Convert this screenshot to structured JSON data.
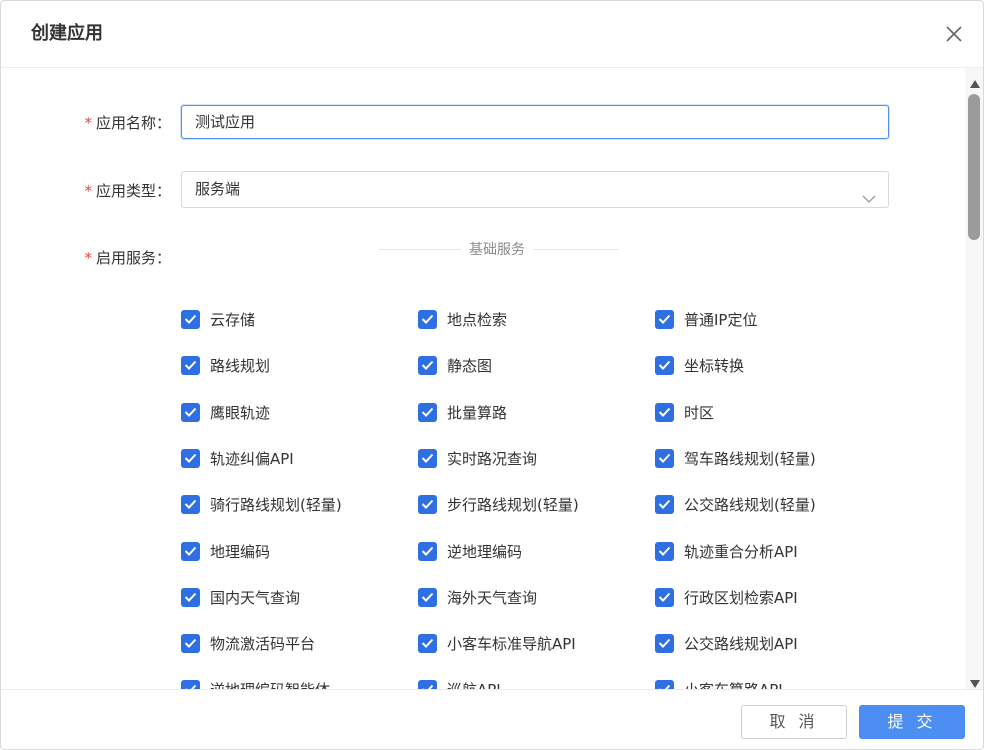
{
  "dialog": {
    "title": "创建应用",
    "close_icon": "close-icon"
  },
  "form": {
    "app_name": {
      "label": "应用名称：",
      "value": "测试应用"
    },
    "app_type": {
      "label": "应用类型：",
      "value": "服务端"
    },
    "services": {
      "label": "启用服务：",
      "group_title": "基础服务"
    }
  },
  "services": [
    [
      "云存储",
      "地点检索",
      "普通IP定位"
    ],
    [
      "路线规划",
      "静态图",
      "坐标转换"
    ],
    [
      "鹰眼轨迹",
      "批量算路",
      "时区"
    ],
    [
      "轨迹纠偏API",
      "实时路况查询",
      "驾车路线规划(轻量)"
    ],
    [
      "骑行路线规划(轻量)",
      "步行路线规划(轻量)",
      "公交路线规划(轻量)"
    ],
    [
      "地理编码",
      "逆地理编码",
      "轨迹重合分析API"
    ],
    [
      "国内天气查询",
      "海外天气查询",
      "行政区划检索API"
    ],
    [
      "物流激活码平台",
      "小客车标准导航API",
      "公交路线规划API"
    ],
    [
      "逆地理编码智能体",
      "巡航API",
      "小客车算路API"
    ]
  ],
  "footer": {
    "cancel_label": "取 消",
    "submit_label": "提 交"
  },
  "colors": {
    "accent": "#4d8ef2",
    "checkbox": "#2f6fe4",
    "required": "#e0474b"
  }
}
